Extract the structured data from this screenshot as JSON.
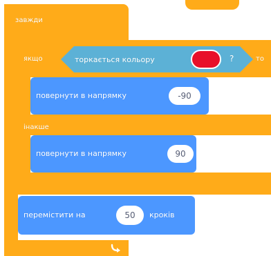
{
  "blocks": {
    "forever": {
      "label": "завжди",
      "loop_icon": "loop-arrow-icon"
    },
    "if_else": {
      "if_label": "якщо",
      "then_label": "то",
      "else_label": "інакше"
    },
    "touching_color": {
      "label": "торкається кольору",
      "question_mark": "?",
      "color": "#e8102a"
    },
    "turn_direction_1": {
      "label": "повернути в напрямку",
      "value": "-90"
    },
    "turn_direction_2": {
      "label": "повернути в напрямку",
      "value": "90"
    },
    "move_steps": {
      "label": "перемістити на",
      "value": "50",
      "suffix": "кроків"
    }
  },
  "colors": {
    "control": "#ffab19",
    "motion": "#4c97ff",
    "sensing": "#5cb1d6"
  }
}
